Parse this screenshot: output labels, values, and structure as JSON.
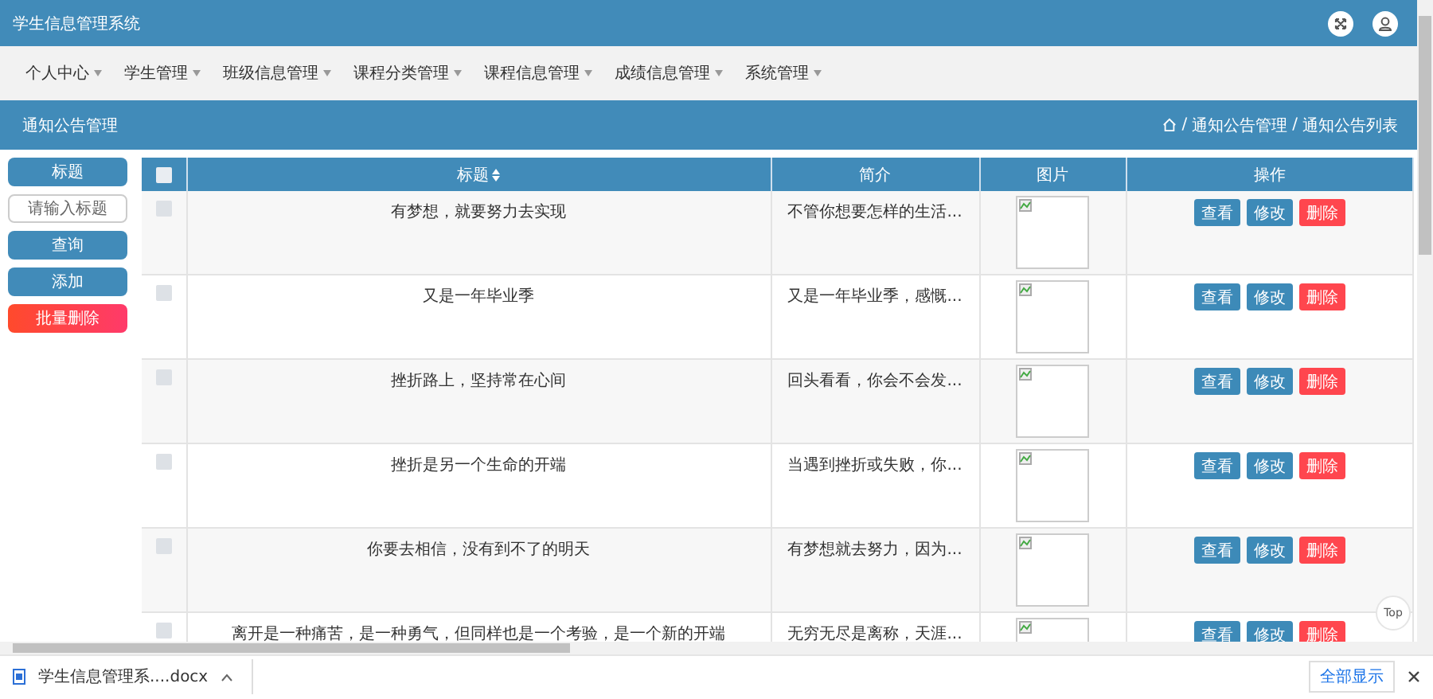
{
  "app": {
    "title": "学生信息管理系统"
  },
  "nav": [
    {
      "label": "个人中心"
    },
    {
      "label": "学生管理"
    },
    {
      "label": "班级信息管理"
    },
    {
      "label": "课程分类管理"
    },
    {
      "label": "课程信息管理"
    },
    {
      "label": "成绩信息管理"
    },
    {
      "label": "系统管理"
    }
  ],
  "page_header": {
    "title": "通知公告管理",
    "separator": "/",
    "breadcrumb": [
      "通知公告管理",
      "通知公告列表"
    ]
  },
  "sidebar": {
    "field_label": "标题",
    "search": {
      "placeholder": "请输入标题"
    },
    "buttons": [
      {
        "label": "查询",
        "kind": "primary"
      },
      {
        "label": "添加",
        "kind": "primary"
      },
      {
        "label": "批量删除",
        "kind": "danger"
      }
    ]
  },
  "table": {
    "select_all": {
      "checked": false
    },
    "columns": [
      "标题",
      "简介",
      "图片",
      "操作"
    ],
    "rows": [
      {
        "checked": false,
        "title": "有梦想，就要努力去实现",
        "intro": "不管你想要怎样的生活...",
        "actions": [
          {
            "label": "查看",
            "kind": "primary"
          },
          {
            "label": "修改",
            "kind": "primary"
          },
          {
            "label": "删除",
            "kind": "danger"
          }
        ]
      },
      {
        "checked": false,
        "title": "又是一年毕业季",
        "intro": "又是一年毕业季，感慨...",
        "actions": [
          {
            "label": "查看",
            "kind": "primary"
          },
          {
            "label": "修改",
            "kind": "primary"
          },
          {
            "label": "删除",
            "kind": "danger"
          }
        ]
      },
      {
        "checked": false,
        "title": "挫折路上，坚持常在心间",
        "intro": "回头看看，你会不会发...",
        "actions": [
          {
            "label": "查看",
            "kind": "primary"
          },
          {
            "label": "修改",
            "kind": "primary"
          },
          {
            "label": "删除",
            "kind": "danger"
          }
        ]
      },
      {
        "checked": false,
        "title": "挫折是另一个生命的开端",
        "intro": "当遇到挫折或失败，你...",
        "actions": [
          {
            "label": "查看",
            "kind": "primary"
          },
          {
            "label": "修改",
            "kind": "primary"
          },
          {
            "label": "删除",
            "kind": "danger"
          }
        ]
      },
      {
        "checked": false,
        "title": "你要去相信，没有到不了的明天",
        "intro": "有梦想就去努力，因为...",
        "actions": [
          {
            "label": "查看",
            "kind": "primary"
          },
          {
            "label": "修改",
            "kind": "primary"
          },
          {
            "label": "删除",
            "kind": "danger"
          }
        ]
      },
      {
        "checked": false,
        "title": "离开是一种痛苦，是一种勇气，但同样也是一个考验，是一个新的开端",
        "intro": "无穷无尽是离称，天涯...",
        "actions": [
          {
            "label": "查看",
            "kind": "primary"
          },
          {
            "label": "修改",
            "kind": "primary"
          },
          {
            "label": "删除",
            "kind": "danger"
          }
        ]
      }
    ]
  },
  "top_button": {
    "label": "Top"
  },
  "download_bar": {
    "file": "学生信息管理系....docx",
    "show_all": "全部显示"
  }
}
